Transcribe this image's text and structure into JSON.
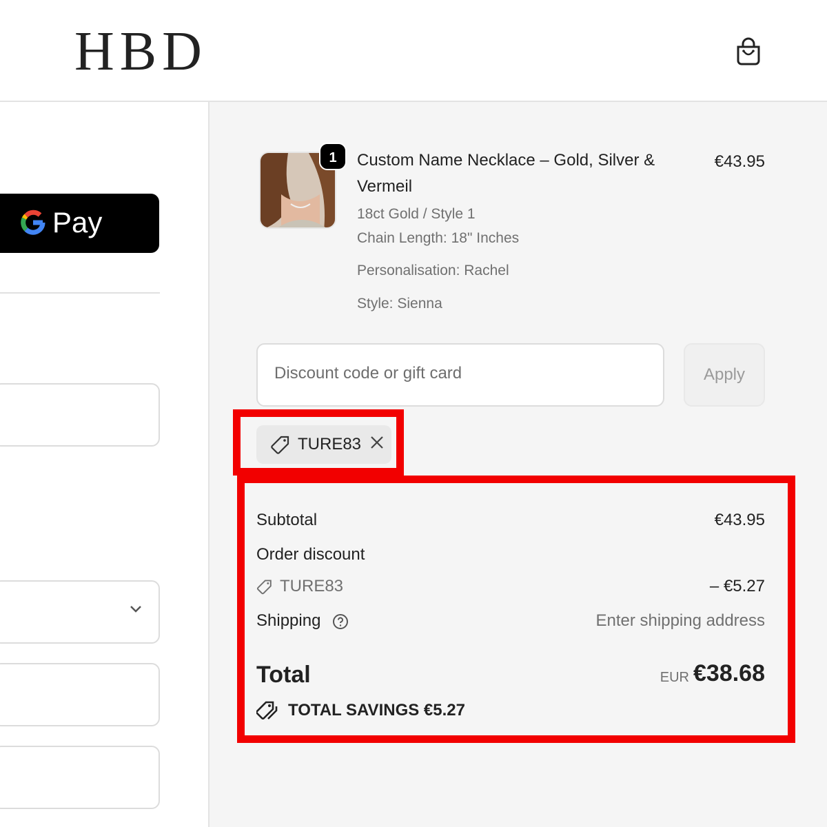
{
  "brand": {
    "logo_text": "HBD"
  },
  "payment": {
    "gpay_label": "Pay"
  },
  "product": {
    "quantity": "1",
    "name": "Custom Name Necklace – Gold, Silver & Vermeil",
    "price": "€43.95",
    "variant": "18ct Gold / Style 1",
    "chain_length": "Chain Length: 18\" Inches",
    "personalisation": "Personalisation: Rachel",
    "style": "Style: Sienna"
  },
  "discount": {
    "placeholder": "Discount code or gift card",
    "apply_label": "Apply",
    "applied_code": "TURE83"
  },
  "summary": {
    "subtotal_label": "Subtotal",
    "subtotal_value": "€43.95",
    "order_discount_label": "Order discount",
    "discount_code": "TURE83",
    "discount_value": "– €5.27",
    "shipping_label": "Shipping",
    "shipping_value": "Enter shipping address",
    "total_label": "Total",
    "currency": "EUR",
    "total_value": "€38.68",
    "savings_text": "TOTAL SAVINGS  €5.27"
  },
  "colors": {
    "highlight": "#f20000",
    "panel_bg": "#f5f5f5",
    "gpay_bg": "#000000"
  }
}
